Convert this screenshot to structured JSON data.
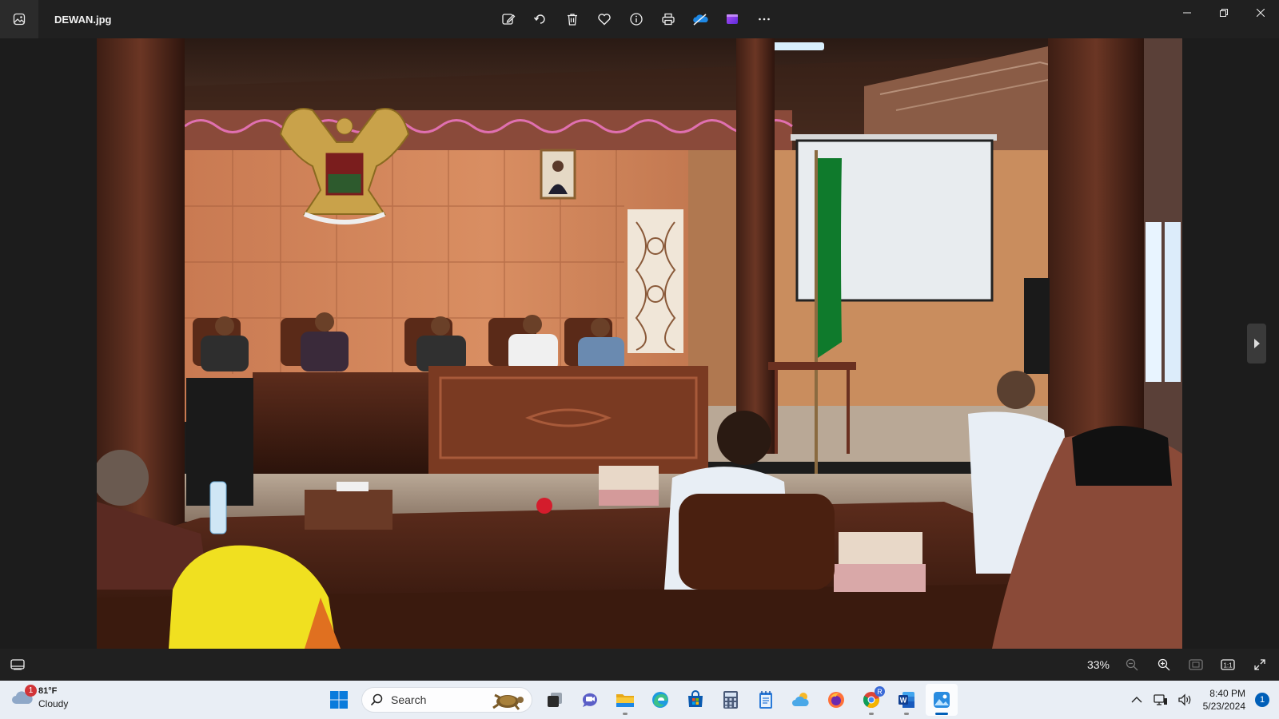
{
  "window": {
    "file_name": "DEWAN.jpg"
  },
  "toolbar": {
    "buttons": [
      "edit-image-icon",
      "rotate-icon",
      "delete-icon",
      "favorite-icon",
      "info-icon",
      "print-icon",
      "onedrive-icon",
      "clipchamp-icon",
      "more-icon"
    ]
  },
  "status": {
    "zoom": "33%"
  },
  "taskbar": {
    "weather": {
      "temp": "81°F",
      "condition": "Cloudy",
      "badge": "1"
    },
    "search_placeholder": "Search",
    "apps": [
      "task-view",
      "teams-chat",
      "file-explorer",
      "edge",
      "microsoft-store",
      "calculator",
      "notepad",
      "weather-app",
      "firefox",
      "chrome",
      "word",
      "photos"
    ],
    "chrome_badge": "R",
    "clock": {
      "time": "8:40 PM",
      "date": "5/23/2024"
    },
    "notifications": "1"
  },
  "colors": {
    "accent": "#005fb8",
    "badge_red": "#d13438",
    "flag_green": "#0f7a2c"
  }
}
